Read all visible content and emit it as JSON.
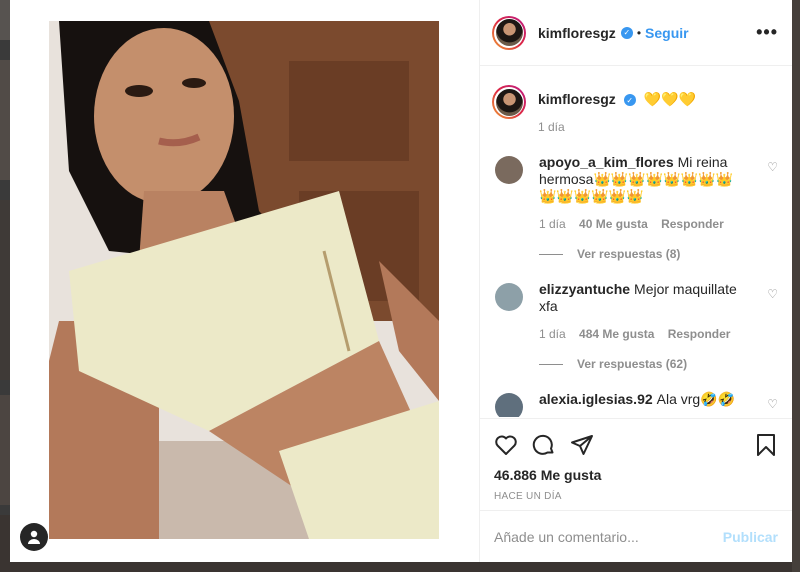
{
  "post": {
    "username": "kimfloresgz",
    "follow_label": "Seguir",
    "dot": "•",
    "more_label": "•••",
    "verified_glyph": "✓"
  },
  "caption": {
    "username": "kimfloresgz",
    "text": "💛💛💛",
    "age": "1 día"
  },
  "comments": [
    {
      "username": "apoyo_a_kim_flores",
      "text": "Mi reina hermosa👑👑👑👑👑👑👑👑👑👑👑👑👑👑",
      "age": "1 día",
      "likes": "40 Me gusta",
      "reply_label": "Responder",
      "view_replies": "Ver respuestas (8)",
      "avatar_color": "#7a6a5e"
    },
    {
      "username": "elizzyantuche",
      "text": "Mejor maquillate xfa",
      "age": "1 día",
      "likes": "484 Me gusta",
      "reply_label": "Responder",
      "view_replies": "Ver respuestas (62)",
      "avatar_color": "#8da0a8"
    },
    {
      "username": "alexia.iglesias.92",
      "text": "Ala vrg🤣🤣",
      "avatar_color": "#5f6f7d"
    }
  ],
  "actions": {
    "likes": "46.886 Me gusta",
    "time": "HACE UN DÍA"
  },
  "add_comment": {
    "placeholder": "Añade un comentario...",
    "publish_label": "Publicar"
  },
  "icons": {
    "like": "heart-icon",
    "comment": "comment-icon",
    "share": "share-icon",
    "save": "bookmark-icon",
    "more": "more-options-icon",
    "verified": "verified-badge-icon",
    "user": "user-icon"
  },
  "colors": {
    "link_blue": "#3897f0",
    "publish_disabled": "#b2dffc",
    "text": "#262626",
    "muted": "#8e8e8e"
  }
}
